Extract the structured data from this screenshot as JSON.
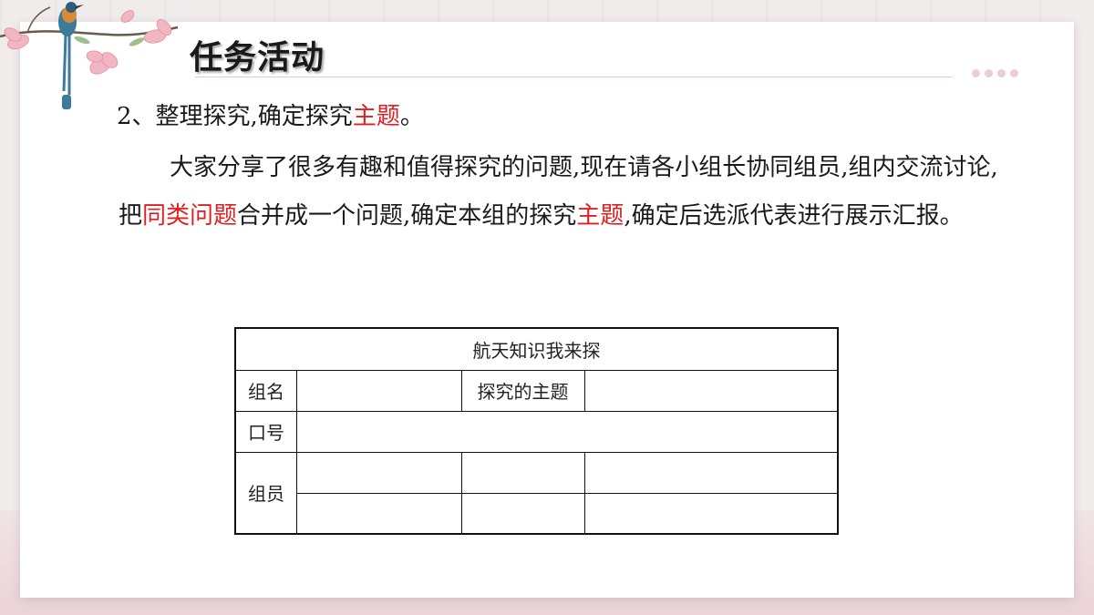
{
  "slide": {
    "title": "任务活动",
    "heading_prefix": "2、整理探究,确定探究",
    "heading_highlight": "主题",
    "heading_suffix": "。",
    "para_part1": "大家分享了很多有趣和值得探究的问题,现在请各小组长协同组员,组内交流讨论,把",
    "para_highlight1": "同类问题",
    "para_part2": "合并成一个问题,确定本组的探究",
    "para_highlight2": "主题",
    "para_part3": ",确定后选派代表进行展示汇报。",
    "highlight_color": "#e02020"
  },
  "form": {
    "title": "航天知识我来探",
    "group_name_label": "组名",
    "topic_label": "探究的主题",
    "slogan_label": "口号",
    "members_label": "组员"
  },
  "decoration": {
    "icon": "bird-on-magnolia-branch-icon",
    "dots_count": 4
  }
}
